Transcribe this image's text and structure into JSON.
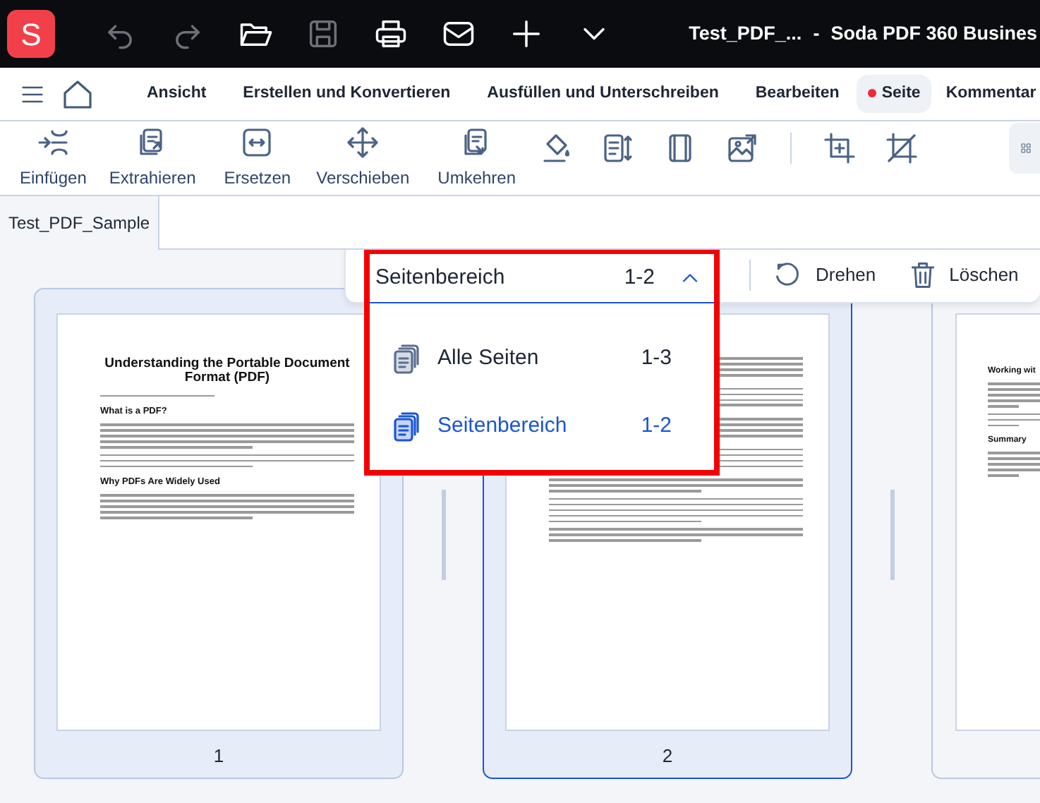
{
  "app": {
    "logo": "S",
    "title": "Test_PDF_...",
    "separator": "-",
    "product": "Soda PDF 360 Busines"
  },
  "quick_actions": [
    {
      "kind": "undo",
      "disabled": true
    },
    {
      "kind": "redo",
      "disabled": true
    },
    {
      "kind": "open",
      "disabled": false
    },
    {
      "kind": "save",
      "disabled": true
    },
    {
      "kind": "print",
      "disabled": false
    },
    {
      "kind": "mail",
      "disabled": false
    },
    {
      "kind": "new",
      "disabled": false
    },
    {
      "kind": "more",
      "disabled": false
    }
  ],
  "menu": [
    {
      "label": "Ansicht",
      "selected": false,
      "dot": false
    },
    {
      "label": "Erstellen und Konvertieren",
      "selected": false,
      "dot": false
    },
    {
      "label": "Ausfüllen und Unterschreiben",
      "selected": false,
      "dot": false
    },
    {
      "label": "Bearbeiten",
      "selected": false,
      "dot": false
    },
    {
      "label": "Seite",
      "selected": true,
      "dot": true
    },
    {
      "label": "Kommentar",
      "selected": false,
      "dot": false
    }
  ],
  "tools": [
    {
      "kind": "insert",
      "label": "Einfügen"
    },
    {
      "kind": "extract",
      "label": "Extrahieren"
    },
    {
      "kind": "replace",
      "label": "Ersetzen"
    },
    {
      "kind": "move",
      "label": "Verschieben"
    },
    {
      "kind": "reverse",
      "label": "Umkehren"
    },
    {
      "kind": "fill"
    },
    {
      "kind": "height"
    },
    {
      "kind": "page"
    },
    {
      "kind": "image"
    }
  ],
  "crop_tools": [
    {
      "kind": "crop"
    },
    {
      "kind": "uncrop"
    }
  ],
  "view_button": {
    "kind": "grid"
  },
  "document_tab": {
    "label": "Test_PDF_Sample",
    "selected": true
  },
  "page_toolbar": {
    "range": {
      "label": "Seitenbereich",
      "value": "1-2",
      "expanded": true
    },
    "actions": [
      {
        "kind": "rotate",
        "label": "Drehen"
      },
      {
        "kind": "delete",
        "label": "Löschen"
      }
    ]
  },
  "range_options": [
    {
      "label": "Alle Seiten",
      "value": "1-3",
      "selected": false
    },
    {
      "label": "Seitenbereich",
      "value": "1-2",
      "selected": true
    }
  ],
  "pages": [
    {
      "number": "1",
      "selected": true,
      "current": false,
      "blocks": [
        {
          "kind": "title",
          "text": "Understanding the Portable Document Format (PDF)"
        },
        {
          "kind": "note"
        },
        {
          "kind": "heading",
          "text": "What is a PDF?"
        },
        {
          "kind": "paragraph"
        },
        {
          "kind": "short"
        },
        {
          "kind": "heading",
          "text": "Why PDFs Are Widely Used"
        },
        {
          "kind": "paragraph"
        }
      ]
    },
    {
      "number": "2",
      "selected": true,
      "current": true,
      "blocks": [
        {
          "kind": "paragraph"
        },
        {
          "kind": "paragraph"
        },
        {
          "kind": "paragraph"
        },
        {
          "kind": "paragraph"
        },
        {
          "kind": "short"
        },
        {
          "kind": "paragraph"
        },
        {
          "kind": "short"
        }
      ]
    },
    {
      "selected": false,
      "current": false,
      "blocks": [
        {
          "kind": "heading",
          "text": "Working wit"
        },
        {
          "kind": "paragraph"
        },
        {
          "kind": "short"
        },
        {
          "kind": "heading",
          "text": "Summary"
        },
        {
          "kind": "paragraph"
        }
      ]
    }
  ]
}
